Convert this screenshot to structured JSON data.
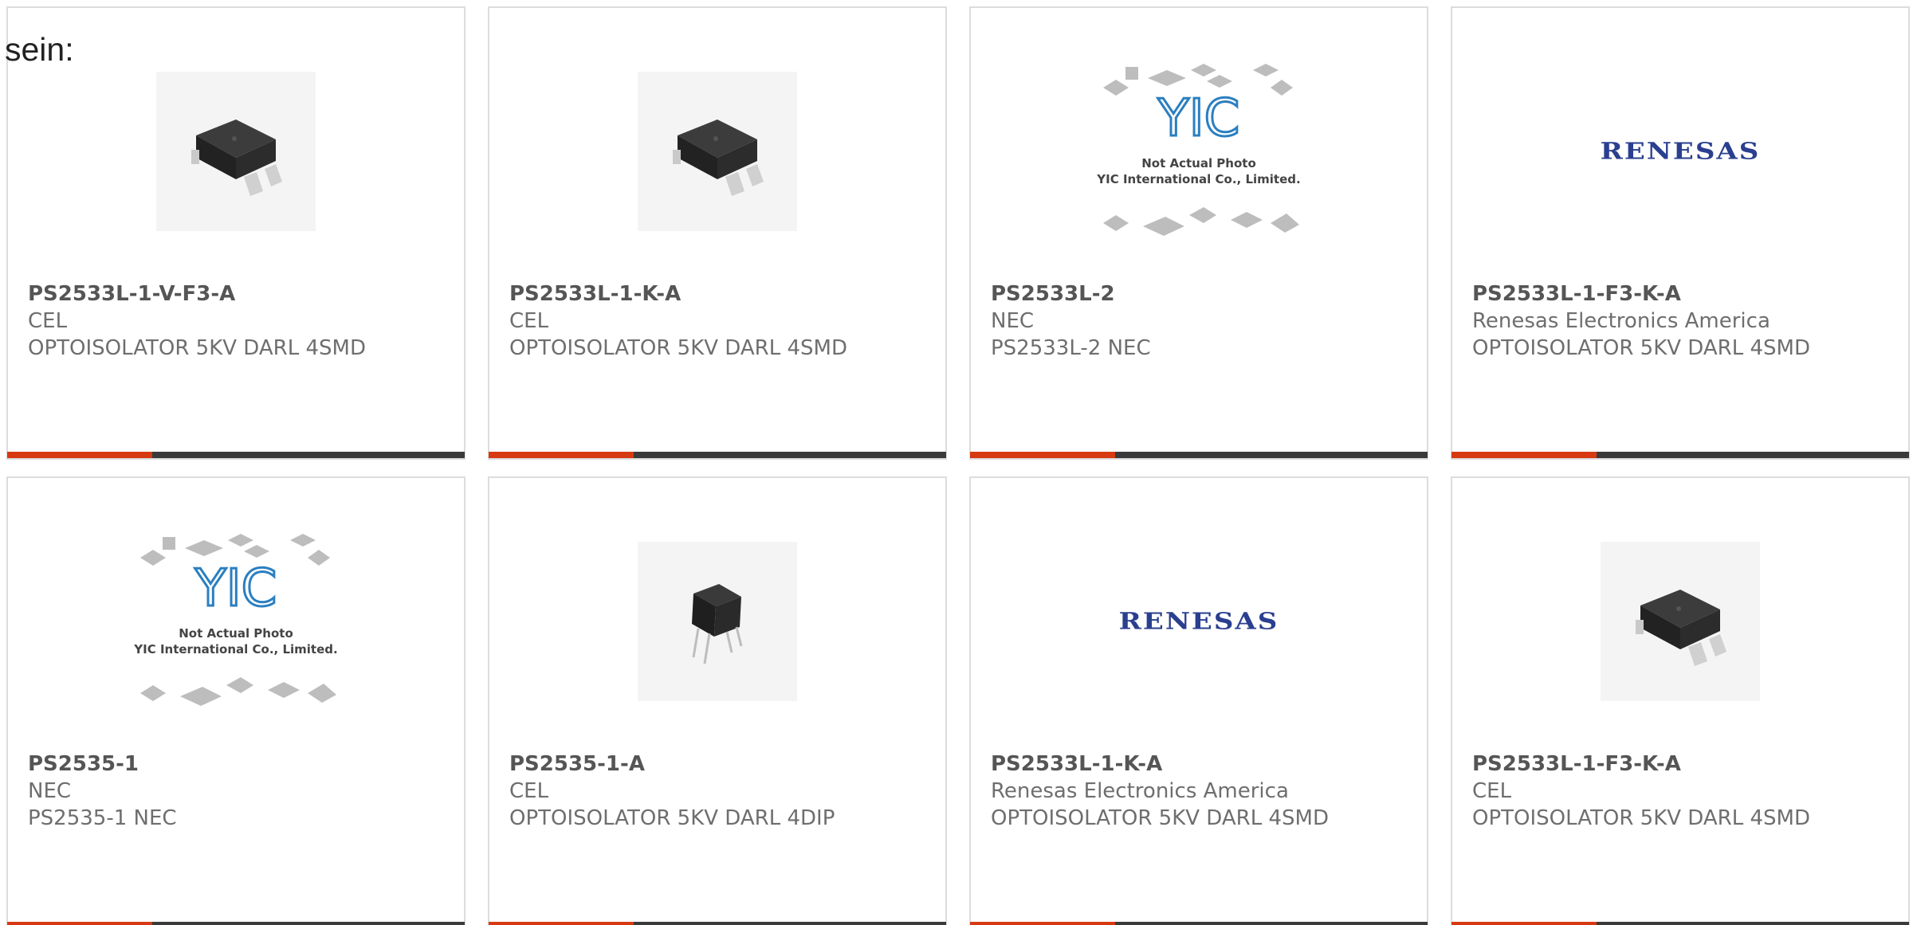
{
  "lead_text": "sein:",
  "colors": {
    "accent": "#d73a12",
    "bar": "#3a3a3a",
    "border": "#dcdcdc",
    "renesas_blue": "#2a3f8f",
    "yic_blue": "#2b7fc0"
  },
  "placeholder": {
    "line1": "Not Actual Photo",
    "line2": "YIC International Co., Limited.",
    "logo": "YIC"
  },
  "renesas_logo_text": "RENESAS",
  "products": [
    {
      "part": "PS2533L-1-V-F3-A",
      "manufacturer": "CEL",
      "description": "OPTOISOLATOR 5KV DARL 4SMD",
      "image": "smd-package"
    },
    {
      "part": "PS2533L-1-K-A",
      "manufacturer": "CEL",
      "description": "OPTOISOLATOR 5KV DARL 4SMD",
      "image": "smd-package"
    },
    {
      "part": "PS2533L-2",
      "manufacturer": "NEC",
      "description": "PS2533L-2 NEC",
      "image": "yic-placeholder"
    },
    {
      "part": "PS2533L-1-F3-K-A",
      "manufacturer": "Renesas Electronics America",
      "description": "OPTOISOLATOR 5KV DARL 4SMD",
      "image": "renesas-logo"
    },
    {
      "part": "PS2535-1",
      "manufacturer": "NEC",
      "description": "PS2535-1 NEC",
      "image": "yic-placeholder"
    },
    {
      "part": "PS2535-1-A",
      "manufacturer": "CEL",
      "description": "OPTOISOLATOR 5KV DARL 4DIP",
      "image": "dip-package"
    },
    {
      "part": "PS2533L-1-K-A",
      "manufacturer": "Renesas Electronics America",
      "description": "OPTOISOLATOR 5KV DARL 4SMD",
      "image": "renesas-logo"
    },
    {
      "part": "PS2533L-1-F3-K-A",
      "manufacturer": "CEL",
      "description": "OPTOISOLATOR 5KV DARL 4SMD",
      "image": "smd-package"
    }
  ]
}
